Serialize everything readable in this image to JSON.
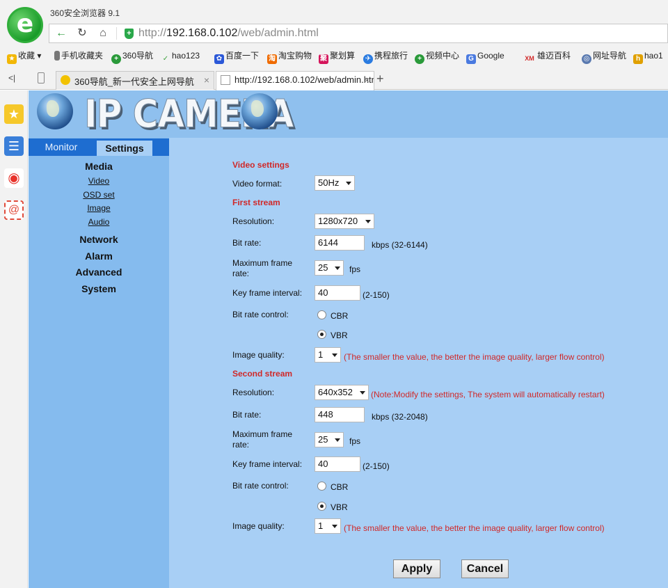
{
  "browser": {
    "title": "360安全浏览器 9.1",
    "url_prefix": "http://",
    "url_host": "192.168.0.102",
    "url_path": "/web/admin.html",
    "bookmarks": [
      {
        "label": "收藏",
        "color": "#f2b705"
      },
      {
        "label": "手机收藏夹",
        "color": "#777777"
      },
      {
        "label": "360导航",
        "color": "#2a9a3a"
      },
      {
        "label": "hao123",
        "color": "#3fa23f"
      },
      {
        "label": "百度一下",
        "color": "#2b58d8"
      },
      {
        "label": "淘宝购物",
        "color": "#ef6b00"
      },
      {
        "label": "聚划算",
        "color": "#d4145a"
      },
      {
        "label": "携程旅行",
        "color": "#2a7be0"
      },
      {
        "label": "视频中心",
        "color": "#2a9a3a"
      },
      {
        "label": "Google",
        "color": "#4a7ae0"
      },
      {
        "label": "雄迈百科",
        "color": "#d02828"
      },
      {
        "label": "网址导航",
        "color": "#5a7ab0"
      },
      {
        "label": "hao1",
        "color": "#e0a000"
      }
    ],
    "tabs": [
      {
        "label": "360导航_新一代安全上网导航"
      },
      {
        "label": "http://192.168.0.102/web/admin.html"
      }
    ]
  },
  "banner": {
    "title": "IP CAMERA"
  },
  "nav": {
    "tab_monitor": "Monitor",
    "tab_settings": "Settings",
    "media": "Media",
    "video": "Video",
    "osd": "OSD set",
    "image": "Image",
    "audio": "Audio",
    "network": "Network",
    "alarm": "Alarm",
    "advanced": "Advanced",
    "system": "System"
  },
  "form": {
    "video_settings_title": "Video settings",
    "video_format_label": "Video format:",
    "video_format_value": "50Hz",
    "first_stream_title": "First stream",
    "second_stream_title": "Second stream",
    "resolution_label": "Resolution:",
    "bit_rate_label": "Bit rate:",
    "max_frame_rate_label_1": "Maximum frame",
    "max_frame_rate_label_2": "rate:",
    "key_frame_label": "Key frame interval:",
    "bit_rate_control_label": "Bit rate control:",
    "image_quality_label": "Image quality:",
    "fps": "fps",
    "cbr": "CBR",
    "vbr": "VBR",
    "quality_note": "(The smaller the value, the better the image quality, larger flow control)",
    "first": {
      "resolution": "1280x720",
      "bit_rate": "6144",
      "bit_rate_range": "kbps (32-6144)",
      "frame_rate": "25",
      "key_frame": "40",
      "key_frame_range": "(2-150)",
      "control": "VBR",
      "quality": "1"
    },
    "second": {
      "resolution": "640x352",
      "resolution_note": "(Note:Modify the settings, The system will automatically restart)",
      "bit_rate": "448",
      "bit_rate_range": "kbps (32-2048)",
      "frame_rate": "25",
      "key_frame": "40",
      "key_frame_range": "(2-150)",
      "control": "VBR",
      "quality": "1"
    },
    "apply": "Apply",
    "cancel": "Cancel"
  }
}
